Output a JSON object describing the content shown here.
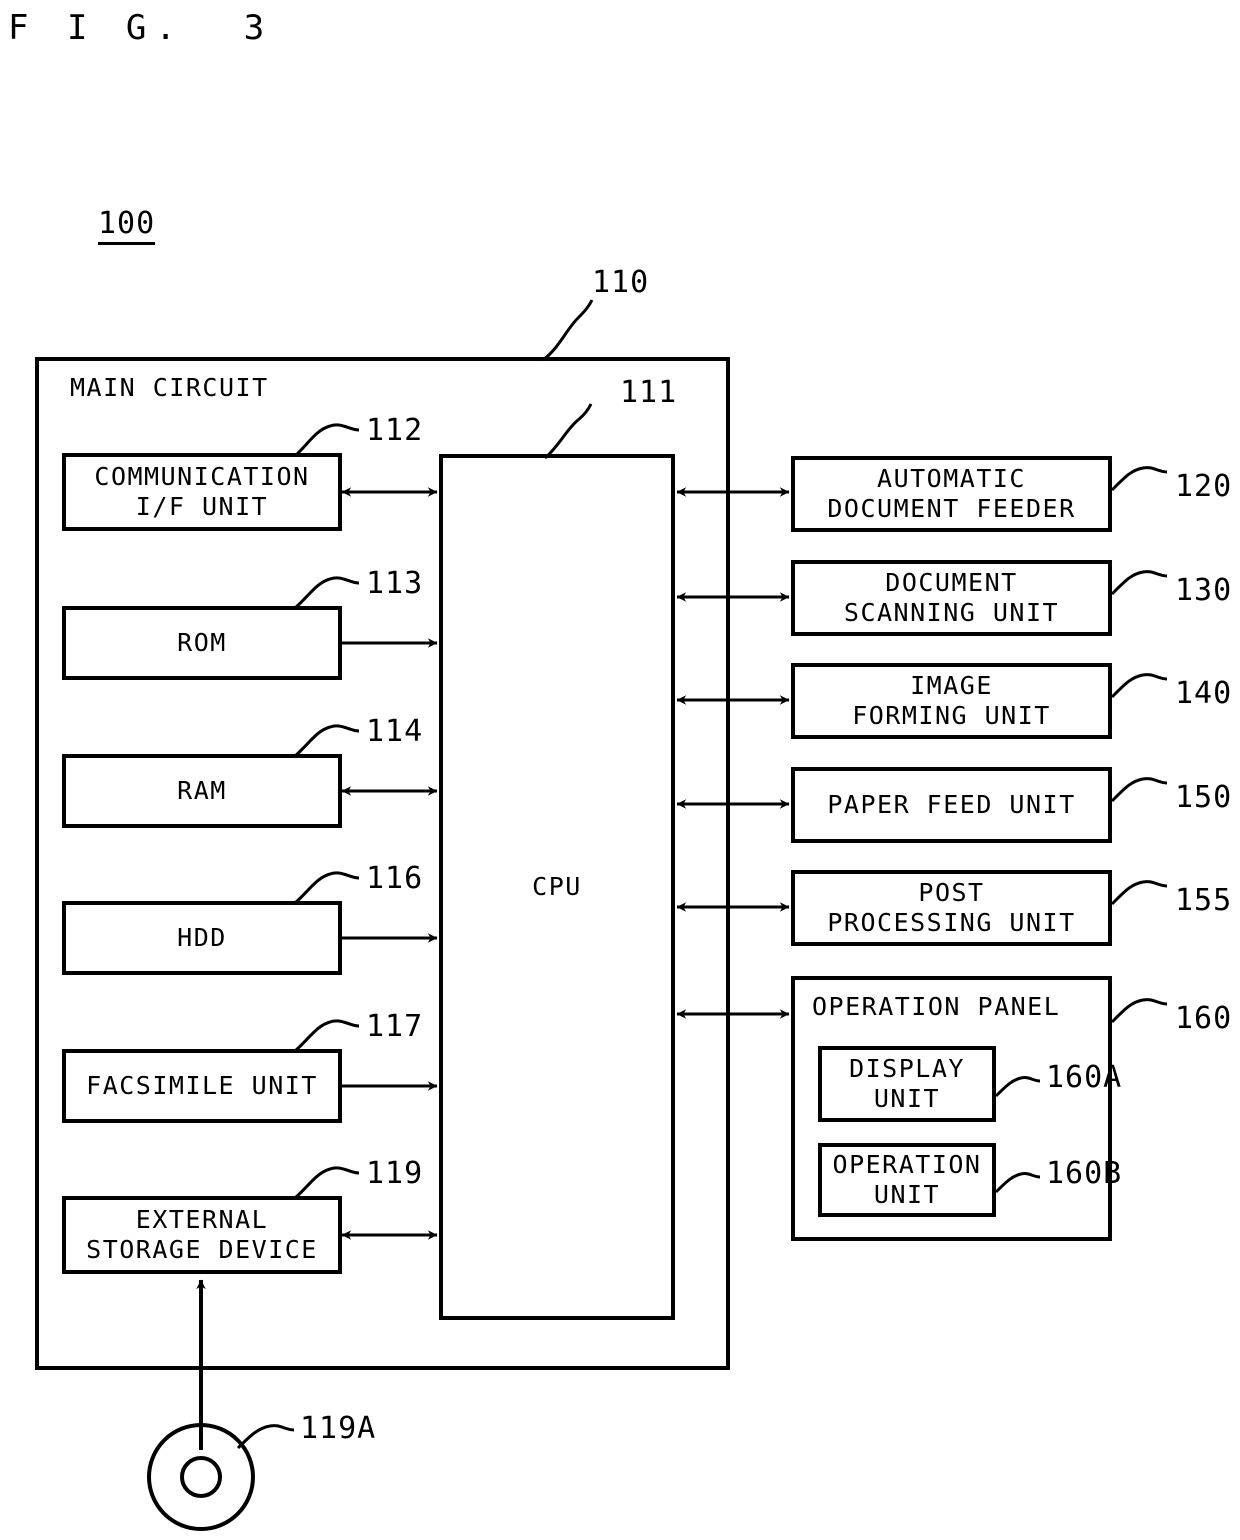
{
  "figure": {
    "title": "F I G.  3",
    "device_ref": "100"
  },
  "main_circuit": {
    "label": "MAIN CIRCUIT",
    "ref": "110"
  },
  "cpu": {
    "label": "CPU",
    "ref": "111"
  },
  "left_blocks": [
    {
      "label": "COMMUNICATION\nI/F UNIT",
      "ref": "112",
      "arrow": "bidirectional"
    },
    {
      "label": "ROM",
      "ref": "113",
      "arrow": "right"
    },
    {
      "label": "RAM",
      "ref": "114",
      "arrow": "bidirectional"
    },
    {
      "label": "HDD",
      "ref": "116",
      "arrow": "right"
    },
    {
      "label": "FACSIMILE UNIT",
      "ref": "117",
      "arrow": "right"
    },
    {
      "label": "EXTERNAL\nSTORAGE DEVICE",
      "ref": "119",
      "arrow": "bidirectional"
    }
  ],
  "right_blocks": [
    {
      "label": "AUTOMATIC\nDOCUMENT FEEDER",
      "ref": "120",
      "arrow": "bidirectional"
    },
    {
      "label": "DOCUMENT\nSCANNING UNIT",
      "ref": "130",
      "arrow": "bidirectional"
    },
    {
      "label": "IMAGE\nFORMING UNIT",
      "ref": "140",
      "arrow": "bidirectional"
    },
    {
      "label": "PAPER FEED UNIT",
      "ref": "150",
      "arrow": "bidirectional"
    },
    {
      "label": "POST\nPROCESSING UNIT",
      "ref": "155",
      "arrow": "bidirectional"
    }
  ],
  "operation_panel": {
    "label": "OPERATION PANEL",
    "ref": "160",
    "arrow": "bidirectional",
    "sub_blocks": [
      {
        "label": "DISPLAY\nUNIT",
        "ref": "160A"
      },
      {
        "label": "OPERATION\nUNIT",
        "ref": "160B"
      }
    ]
  },
  "removable_media": {
    "ref": "119A",
    "icon": "disc-media-icon"
  },
  "colors": {
    "ink": "#000000",
    "paper": "#ffffff"
  }
}
